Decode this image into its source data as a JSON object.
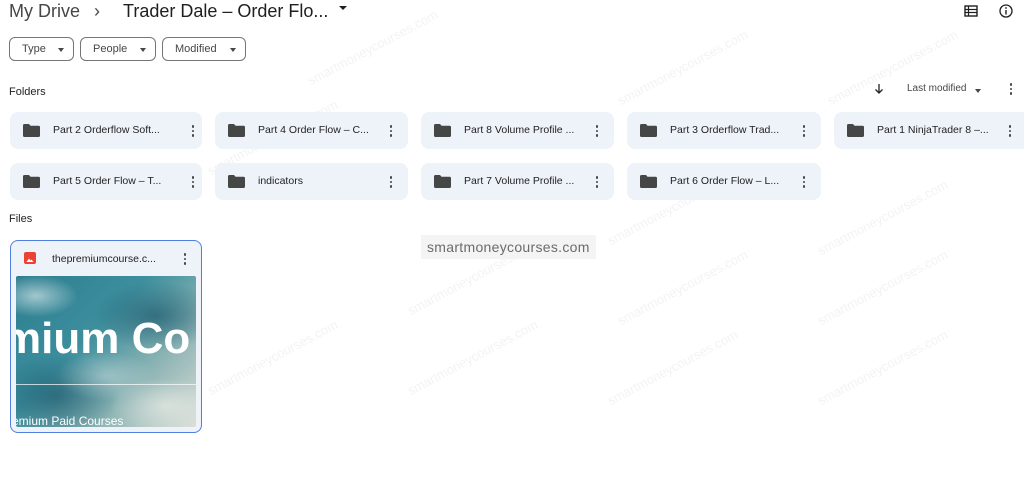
{
  "breadcrumb": {
    "root": "My Drive",
    "separator": "›",
    "current": "Trader Dale – Order Flo..."
  },
  "header_icons": {
    "list_view": "list-view-icon",
    "info": "info-icon"
  },
  "filters": [
    {
      "label": "Type"
    },
    {
      "label": "People"
    },
    {
      "label": "Modified"
    }
  ],
  "sections": {
    "folders_label": "Folders",
    "files_label": "Files"
  },
  "sort": {
    "label": "Last modified",
    "direction_icon": "arrow-down-icon"
  },
  "folders": [
    {
      "name": "Part 2 Orderflow Soft..."
    },
    {
      "name": "Part 4 Order Flow – C..."
    },
    {
      "name": "Part 8 Volume Profile ..."
    },
    {
      "name": "Part 3 Orderflow Trad..."
    },
    {
      "name": "Part 1 NinjaTrader 8 –..."
    },
    {
      "name": "Part 5 Order Flow – T..."
    },
    {
      "name": "indicators"
    },
    {
      "name": "Part 7 Volume Profile ..."
    },
    {
      "name": "Part 6 Order Flow – L..."
    }
  ],
  "files": [
    {
      "name": "thepremiumcourse.c...",
      "type_icon": "image-file-icon",
      "thumbnail_title": "mium Co",
      "thumbnail_subtitle": "remium Paid Courses"
    }
  ],
  "watermark": {
    "text": "smartmoneycourses.com"
  },
  "colors": {
    "tile_bg": "#eef2f9",
    "selected_border": "#4f7fe0",
    "image_icon": "#ea4335"
  }
}
